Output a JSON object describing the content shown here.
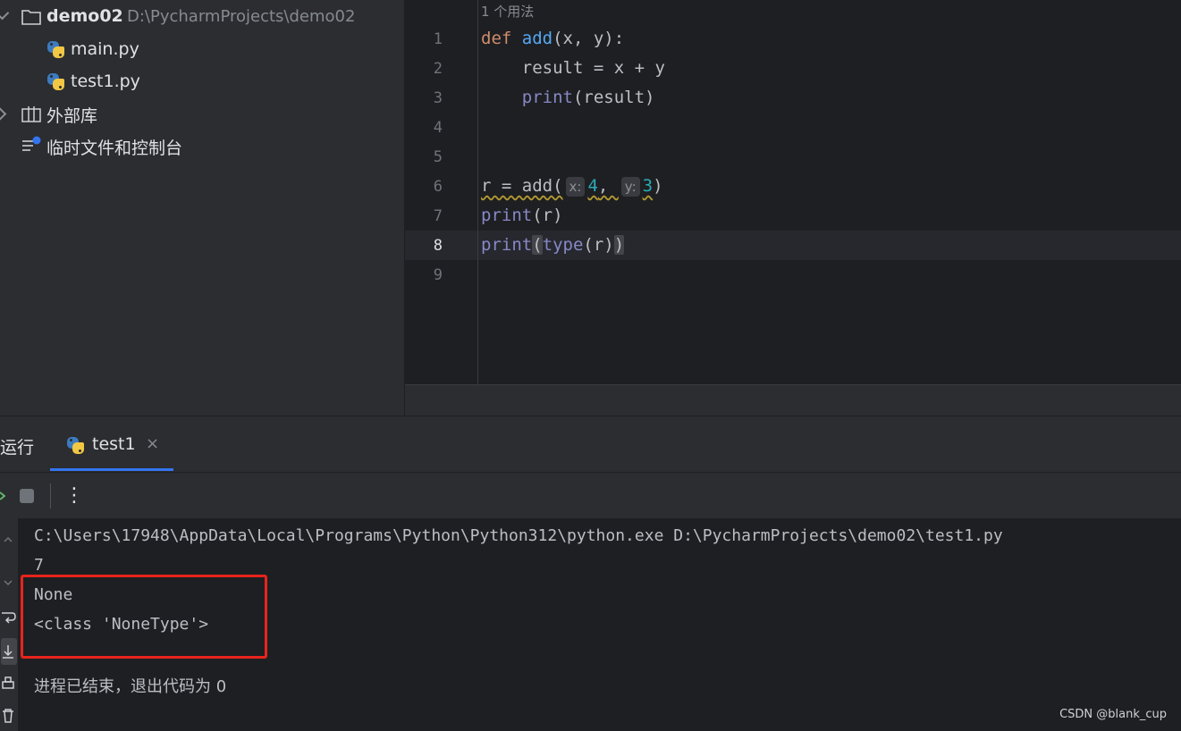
{
  "project": {
    "root_name": "demo02",
    "root_path": "D:\\PycharmProjects\\demo02",
    "files": [
      "main.py",
      "test1.py"
    ],
    "external_libs": "外部库",
    "scratches": "临时文件和控制台"
  },
  "editor": {
    "usages_hint": "1 个用法",
    "line_numbers": [
      "1",
      "2",
      "3",
      "4",
      "5",
      "6",
      "7",
      "8",
      "9"
    ],
    "current_line": "8",
    "code": {
      "l1_kw": "def",
      "l1_fn": "add",
      "l1_rest": "(x, y):",
      "l2": "    result = x + y",
      "l3_indent": "    ",
      "l3_fn": "print",
      "l3_rest": "(result)",
      "l6_a": "r = add(",
      "l6_hint_x": "x:",
      "l6_num1": "4",
      "l6_comma": ", ",
      "l6_hint_y": "y:",
      "l6_num2": "3",
      "l6_close": ")",
      "l7_fn": "print",
      "l7_rest": "(r)",
      "l8_fn": "print",
      "l8_open": "(",
      "l8_type": "type",
      "l8_rest": "(r)",
      "l8_close": ")"
    }
  },
  "run": {
    "title": "运行",
    "tab_label": "test1",
    "close_glyph": "×",
    "more_glyph": "⋮",
    "output": [
      "C:\\Users\\17948\\AppData\\Local\\Programs\\Python\\Python312\\python.exe D:\\PycharmProjects\\demo02\\test1.py",
      "7",
      "None",
      "<class 'NoneType'>",
      "进程已结束，退出代码为 0"
    ]
  },
  "watermark": "CSDN @blank_cup",
  "colors": {
    "keyword": "#cf8e6d",
    "function": "#56a8f5",
    "builtin": "#8888c6",
    "number": "#2aacb8",
    "highlight_box": "#e8241c",
    "tab_underline": "#3574f0"
  }
}
